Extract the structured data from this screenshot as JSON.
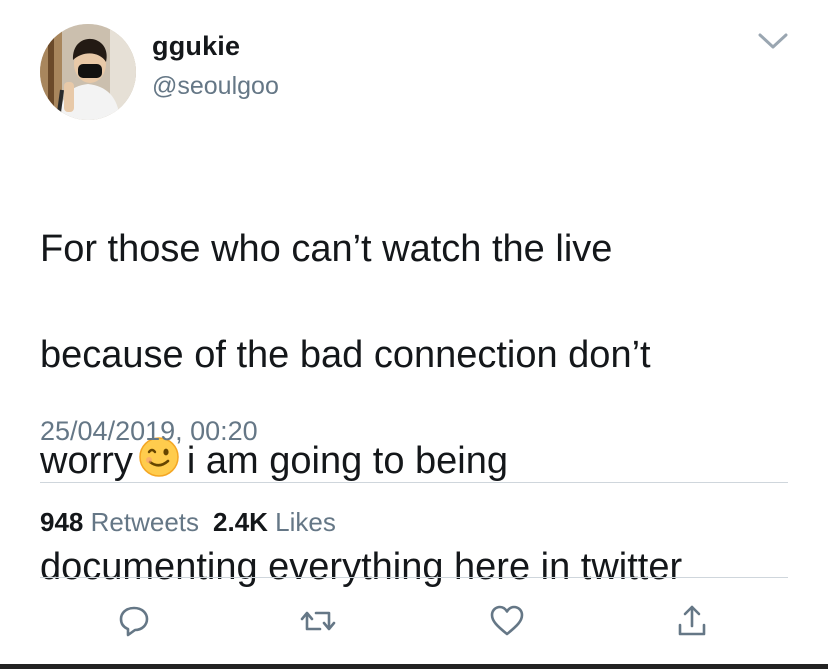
{
  "user": {
    "display_name": "ggukie",
    "handle": "@seoulgoo"
  },
  "tweet": {
    "line1": "For those who can’t watch the live",
    "line2": "because of the bad connection don’t",
    "line3_before_emoji": "worry",
    "emoji": "winking-face",
    "line3_after_emoji": "i am going to being",
    "line4": "documenting everything here in twitter",
    "timestamp": "25/04/2019, 00:20"
  },
  "stats": {
    "retweets_count": "948",
    "retweets_label": "Retweets",
    "likes_count": "2.4K",
    "likes_label": "Likes"
  },
  "actions": [
    {
      "icon": "reply-icon"
    },
    {
      "icon": "retweet-icon"
    },
    {
      "icon": "like-icon"
    },
    {
      "icon": "share-icon"
    }
  ],
  "colors": {
    "text_primary": "#14171a",
    "text_secondary": "#657786",
    "divider": "#cfd6dc"
  }
}
